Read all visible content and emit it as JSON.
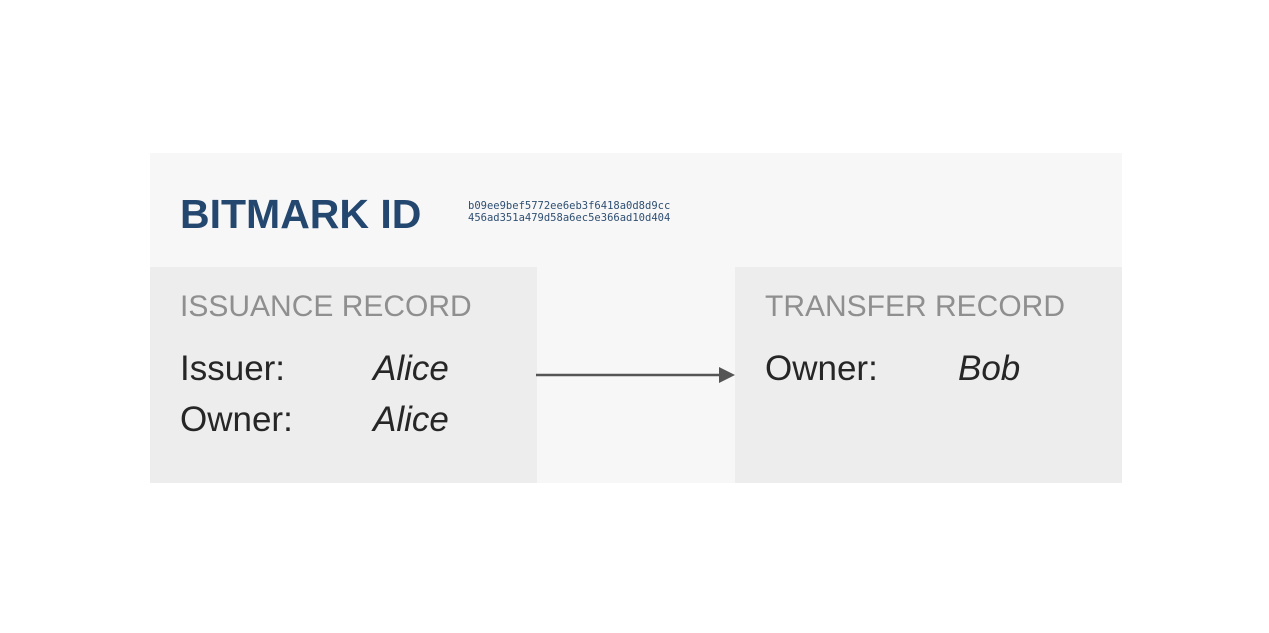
{
  "header": {
    "title": "BITMARK ID",
    "hash_lines": [
      "b09ee9bef5772ee6eb3f6418a0d8d9cc",
      "456ad351a479d58a6ec5e366ad10d404"
    ]
  },
  "issuance": {
    "title": "ISSUANCE RECORD",
    "fields": [
      {
        "label": "Issuer:",
        "value": "Alice"
      },
      {
        "label": "Owner:",
        "value": "Alice"
      }
    ]
  },
  "transfer": {
    "title": "TRANSFER RECORD",
    "fields": [
      {
        "label": "Owner:",
        "value": "Bob"
      }
    ]
  },
  "colors": {
    "title": "#24476f",
    "record_title": "#8f8f8f",
    "text": "#262626",
    "panel": "#f7f7f7",
    "record_bg": "#ededed",
    "arrow": "#555555"
  }
}
